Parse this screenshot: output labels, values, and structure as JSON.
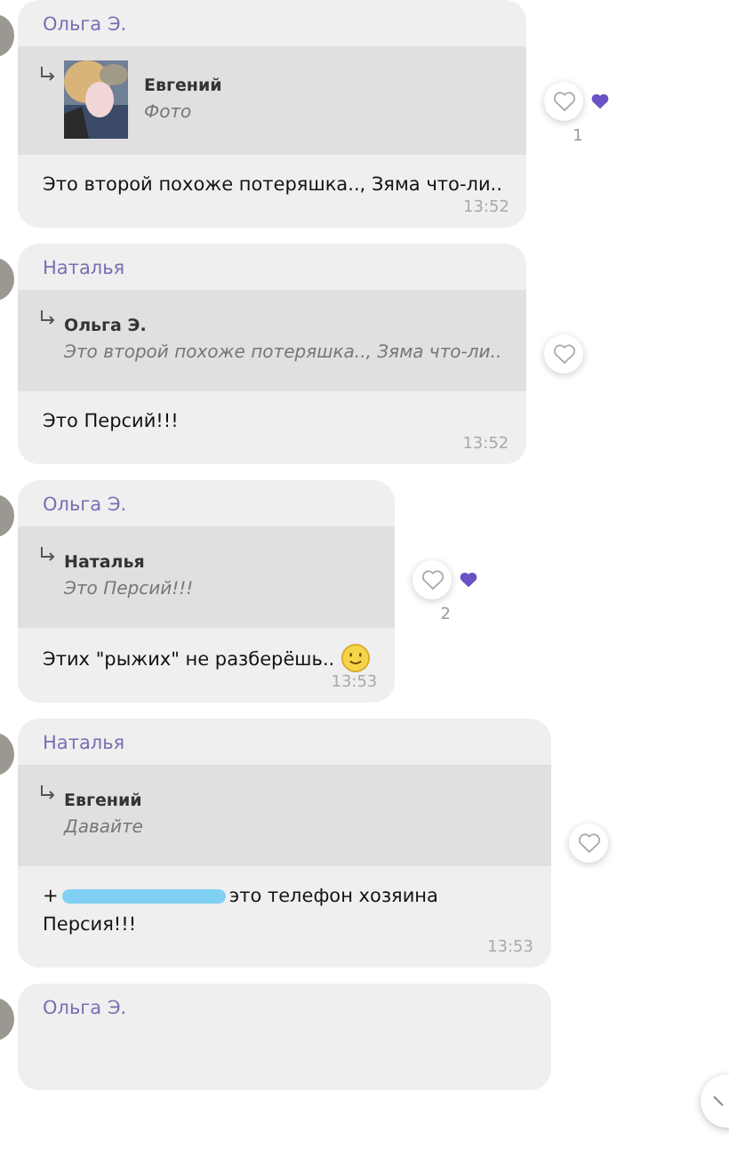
{
  "messages": [
    {
      "sender": "Ольга Э.",
      "quote": {
        "author": "Евгений",
        "text": "Фото"
      },
      "text": "Это второй похоже потеряшка.., Зяма что-ли..",
      "time": "13:52",
      "reactions": {
        "liked_by_others": true,
        "count": "1"
      }
    },
    {
      "sender": "Наталья",
      "quote": {
        "kind": "text",
        "author": "Ольга Э.",
        "text": "Это второй похоже потеряшка.., Зяма что-ли.."
      },
      "text": "Это Персий!!!",
      "time": "13:52",
      "reactions": {
        "liked_by_others": false
      }
    },
    {
      "sender": "Ольга Э.",
      "quote": {
        "kind": "text",
        "author": "Наталья",
        "text": "Это Персий!!!"
      },
      "text": "Этих \"рыжих\" не разберёшь..",
      "emoji": true,
      "time": "13:53",
      "reactions": {
        "liked_by_others": true,
        "count": "2"
      }
    },
    {
      "sender": "Наталья",
      "quote": {
        "kind": "text",
        "author": "Евгений",
        "text": "Давайте"
      },
      "text_prefix": "+",
      "redacted": true,
      "text": "это телефон хозяина Персия!!!",
      "time": "13:53",
      "reactions": {
        "liked_by_others": false
      }
    },
    {
      "sender": "Ольга Э."
    }
  ]
}
